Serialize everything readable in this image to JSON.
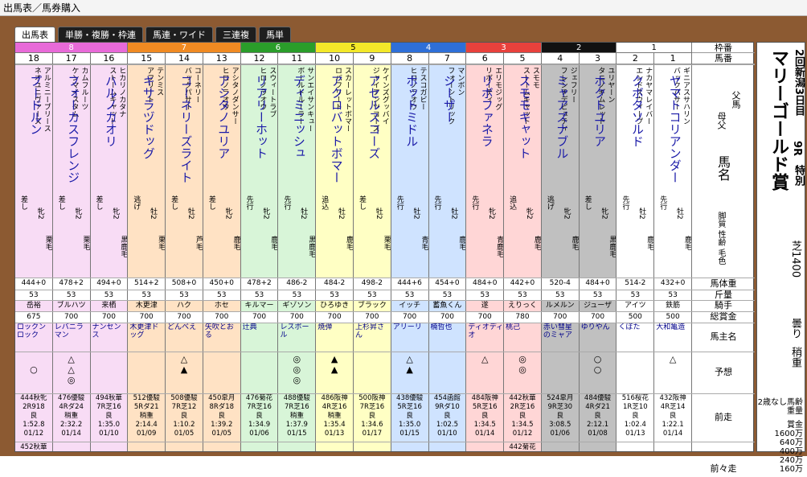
{
  "titlebar": "出馬表／馬券購入",
  "tabs": [
    "出馬表",
    "単勝・複勝・枠連",
    "馬連・ワイド",
    "三連複",
    "馬単"
  ],
  "race": {
    "kaisai": "2回新潟3日目",
    "race_no": "9R",
    "grade": "特別",
    "name": "マリーゴールド賞",
    "course": "芝1400",
    "weather": "曇り",
    "going": "稍重",
    "conditions": "2歳なし馬齢重量",
    "prize_label": "賞金",
    "prizes": [
      "1600万",
      "640万",
      "400万",
      "240万",
      "160万"
    ]
  },
  "headers": [
    "枠番",
    "馬番",
    "母父",
    "馬名",
    "脚質 性齢 毛色",
    "馬体重",
    "斤量",
    "騎手",
    "総賞金",
    "馬主名",
    "予想",
    "前走",
    "前々走"
  ],
  "horses": [
    {
      "waku": 8,
      "no": "18",
      "sire": "アルミニーブリース",
      "dam": "ネオユニヴァース",
      "name": "プードルン",
      "style": "差し",
      "sex": "牝2",
      "coat": "栗毛",
      "weight": "444+0",
      "kin": "53",
      "jockey": "岳裕",
      "prize": "675",
      "owner": "ロックンロック",
      "marks": [
        "",
        "○",
        ""
      ],
      "prev": [
        "444秋牝",
        "2R918",
        "良",
        "1:52.8",
        "01/12"
      ],
      "prev2": [
        "452秋華",
        "5Rダ16",
        "重",
        "1:39.8",
        "03/14"
      ]
    },
    {
      "waku": 8,
      "no": "17",
      "sire": "カムフルーツ",
      "dam": "ケンマイスタム",
      "name": "フォーカスフレンジ",
      "style": "差し",
      "sex": "牝2",
      "coat": "栗毛",
      "weight": "478+2",
      "kin": "53",
      "jockey": "ブルハツ",
      "prize": "700",
      "owner": "レバニラマン",
      "marks": [
        "△",
        "△",
        "◎"
      ],
      "prev": [
        "476優駿",
        "4Rダ24",
        "稍重",
        "2:32.2",
        "01/14"
      ],
      "prev2": []
    },
    {
      "waku": 8,
      "no": "16",
      "sire": "ヒカリノカタナ",
      "dam": "ストームキャット",
      "name": "ハルノカオリ",
      "style": "差し",
      "sex": "牝2",
      "coat": "黒鹿毛",
      "weight": "494+0",
      "kin": "53",
      "jockey": "来栖",
      "prize": "700",
      "owner": "ナンセンス",
      "marks": [
        "",
        "",
        ""
      ],
      "prev": [
        "494秋華",
        "7R芝16",
        "良",
        "1:35.0",
        "01/10"
      ],
      "prev2": []
    },
    {
      "waku": 7,
      "no": "15",
      "sire": "テンミス",
      "dam": "アフリート",
      "name": "キサラヅドッグ",
      "style": "逃げ",
      "sex": "牡2",
      "coat": "栗毛",
      "weight": "514+2",
      "kin": "53",
      "jockey": "木更津",
      "prize": "700",
      "owner": "木更津ドッグ",
      "marks": [
        "",
        "",
        ""
      ],
      "prev": [
        "512優駿",
        "5Rダ21",
        "稍重",
        "2:14.4",
        "01/09"
      ],
      "prev2": []
    },
    {
      "waku": 7,
      "no": "14",
      "sire": "コーネリー",
      "dam": "バックパサー",
      "name": "コーネリーズライト",
      "style": "差し",
      "sex": "牡2",
      "coat": "芦毛",
      "weight": "508+0",
      "kin": "53",
      "jockey": "ハク",
      "prize": "700",
      "owner": "どんべえ",
      "marks": [
        "△",
        "▲",
        ""
      ],
      "prev": [
        "508優駿",
        "7R芝12",
        "良",
        "1:10.2",
        "01/05"
      ],
      "prev2": []
    },
    {
      "waku": 7,
      "no": "13",
      "sire": "アシタノダンサー",
      "dam": "ヒロノラオウ",
      "name": "アシタノユリア",
      "style": "差し",
      "sex": "牝2",
      "coat": "鹿毛",
      "weight": "450+0",
      "kin": "53",
      "jockey": "ホセ",
      "prize": "700",
      "owner": "矢吹とおる",
      "marks": [
        "",
        "",
        ""
      ],
      "prev": [
        "450皐月",
        "8Rダ18",
        "良",
        "1:39.2",
        "01/05"
      ],
      "prev2": []
    },
    {
      "waku": 6,
      "no": "12",
      "sire": "スウィートラブ",
      "dam": "ヒロノラオウ",
      "name": "リアリーホット",
      "style": "先行",
      "sex": "牝2",
      "coat": "鹿毛",
      "weight": "478+2",
      "kin": "53",
      "jockey": "キルマー",
      "prize": "700",
      "owner": "辻典",
      "marks": [
        "",
        "",
        ""
      ],
      "prev": [
        "476菊花",
        "7R芝16",
        "良",
        "1:34.9",
        "01/06"
      ],
      "prev2": []
    },
    {
      "waku": 6,
      "no": "11",
      "sire": "サンエイサンキュー",
      "dam": "ボールドルーラー",
      "name": "ディミニッシュ",
      "style": "先行",
      "sex": "牡2",
      "coat": "黒鹿毛",
      "weight": "486-2",
      "kin": "53",
      "jockey": "ギゾソン",
      "prize": "700",
      "owner": "レスポール",
      "marks": [
        "◎",
        "◎",
        "◎"
      ],
      "prev": [
        "488優駿",
        "7R芝16",
        "稍重",
        "1:37.9",
        "01/15"
      ],
      "prev2": []
    },
    {
      "waku": 5,
      "no": "10",
      "sire": "スカーレットボマー",
      "dam": "ロバフリート",
      "name": "アクロバットボマー",
      "style": "追込",
      "sex": "牡2",
      "coat": "鹿毛",
      "weight": "484-2",
      "kin": "53",
      "jockey": "ひろゆき",
      "prize": "700",
      "owner": "焼弾",
      "marks": [
        "▲",
        "▲",
        ""
      ],
      "prev": [
        "486阪神",
        "4R芝16",
        "稍重",
        "1:35.4",
        "01/13"
      ],
      "prev2": []
    },
    {
      "waku": 5,
      "no": "9",
      "sire": "ケインズグッバイ",
      "dam": "ジャイアンツコーズ",
      "name": "アセルスコーズ",
      "style": "差し",
      "sex": "牡2",
      "coat": "栗毛",
      "weight": "498-2",
      "kin": "53",
      "jockey": "ブラック",
      "prize": "700",
      "owner": "上杉昇さん",
      "marks": [
        "",
        "",
        ""
      ],
      "prev": [
        "500阪神",
        "7R芝16",
        "良",
        "1:34.6",
        "01/17"
      ],
      "prev2": []
    },
    {
      "waku": 4,
      "no": "8",
      "sire": "テスコガビー",
      "dam": "ヒロノラオウ",
      "name": "ホットミドル",
      "style": "先行",
      "sex": "牡2",
      "coat": "青毛",
      "weight": "444+6",
      "kin": "53",
      "jockey": "イッチ",
      "prize": "700",
      "owner": "アリーリ",
      "marks": [
        "△",
        "▲",
        ""
      ],
      "prev": [
        "438優駿",
        "5R芝16",
        "良",
        "1:35.0",
        "01/15"
      ],
      "prev2": []
    },
    {
      "waku": 4,
      "no": "7",
      "sire": "マンボン",
      "dam": "フォーシトリック",
      "name": "シーザー",
      "style": "先行",
      "sex": "牡2",
      "coat": "鹿毛",
      "weight": "454+0",
      "kin": "53",
      "jockey": "蓄魚くん",
      "prize": "700",
      "owner": "楠哲也",
      "marks": [
        "",
        "",
        ""
      ],
      "prev": [
        "454函館",
        "9Rダ10",
        "良",
        "1:02.5",
        "01/10"
      ],
      "prev2": []
    },
    {
      "waku": 3,
      "no": "6",
      "sire": "エリモジッグ",
      "dam": "リボーティ",
      "name": "リボファネラ",
      "style": "先行",
      "sex": "牝2",
      "coat": "青鹿毛",
      "weight": "484+0",
      "kin": "53",
      "jockey": "遂",
      "prize": "700",
      "owner": "ディオディオ",
      "marks": [
        "△",
        "",
        ""
      ],
      "prev": [
        "484阪神",
        "5R芝16",
        "良",
        "1:34.5",
        "01/14"
      ],
      "prev2": []
    },
    {
      "waku": 3,
      "no": "5",
      "sire": "スモモ",
      "dam": "ストームキャット",
      "name": "スモモキャット",
      "style": "追込",
      "sex": "牝2",
      "coat": "鹿毛",
      "weight": "442+0",
      "kin": "53",
      "jockey": "えりっく",
      "prize": "780",
      "owner": "桃己",
      "marks": [
        "◎",
        "◎",
        ""
      ],
      "prev": [
        "442秋華",
        "2R芝16",
        "良",
        "1:34.5",
        "01/12"
      ],
      "prev2": [
        "442菊花",
        "5Rダ16",
        "重",
        "1:39.2",
        "02/10"
      ]
    },
    {
      "waku": 2,
      "no": "4",
      "sire": "ジェフリー",
      "dam": "フレンチデピュティ",
      "name": "ミャアズナブル",
      "style": "逃げ",
      "sex": "牝2",
      "coat": "鹿毛",
      "weight": "520-4",
      "kin": "53",
      "jockey": "ルメルン",
      "prize": "700",
      "owner": "赤い彗星のミャア",
      "marks": [
        "",
        "",
        ""
      ],
      "prev": [
        "524皐月",
        "9R芝30",
        "良",
        "3:08.5",
        "01/06"
      ],
      "prev2": []
    },
    {
      "waku": 2,
      "no": "3",
      "sire": "ユリヤーン",
      "dam": "タニノギムレット",
      "name": "ホクトユリア",
      "style": "差し",
      "sex": "牝2",
      "coat": "黒鹿毛",
      "weight": "484+0",
      "kin": "53",
      "jockey": "ジューザ",
      "prize": "700",
      "owner": "ゆりやん",
      "marks": [
        "○",
        "○",
        ""
      ],
      "prev": [
        "484優駿",
        "4Rダ21",
        "良",
        "2:12.1",
        "01/08"
      ],
      "prev2": []
    },
    {
      "waku": 1,
      "no": "2",
      "sire": "ナカヤマレイバー",
      "dam": "エンドスウィープ",
      "name": "クボタソルド",
      "style": "先行",
      "sex": "牡2",
      "coat": "鹿毛",
      "weight": "514-2",
      "kin": "53",
      "jockey": "アイツ",
      "prize": "500",
      "owner": "くぼた",
      "marks": [
        "",
        "",
        ""
      ],
      "prev": [
        "516桜花",
        "1R芝10",
        "良",
        "1:02.4",
        "01/13"
      ],
      "prev2": []
    },
    {
      "waku": 1,
      "no": "1",
      "sire": "ギニアスサハリン",
      "dam": "バックパサー",
      "name": "ヤマトコリアンダー",
      "style": "先行",
      "sex": "牡2",
      "coat": "鹿毛",
      "weight": "432+0",
      "kin": "53",
      "jockey": "鉄筋",
      "prize": "500",
      "owner": "大和亀造",
      "marks": [
        "△",
        "",
        ""
      ],
      "prev": [
        "432阪神",
        "4R芝14",
        "良",
        "1:22.1",
        "01/14"
      ],
      "prev2": []
    }
  ],
  "waku_colors": {
    "1": {
      "head": "#ffffff",
      "bg": "#ffffff",
      "fg": "#000"
    },
    "2": {
      "head": "#111111",
      "bg": "#c0c0c0",
      "fg": "#fff"
    },
    "3": {
      "head": "#e8413c",
      "bg": "#ffd6d6",
      "fg": "#fff"
    },
    "4": {
      "head": "#2e6fd8",
      "bg": "#cfe3ff",
      "fg": "#fff"
    },
    "5": {
      "head": "#f3e829",
      "bg": "#ffffc4",
      "fg": "#000"
    },
    "6": {
      "head": "#2a9d2a",
      "bg": "#d8f5d8",
      "fg": "#fff"
    },
    "7": {
      "head": "#f08a22",
      "bg": "#ffe2c4",
      "fg": "#fff"
    },
    "8": {
      "head": "#e86ad8",
      "bg": "#f8dcf5",
      "fg": "#fff"
    }
  }
}
